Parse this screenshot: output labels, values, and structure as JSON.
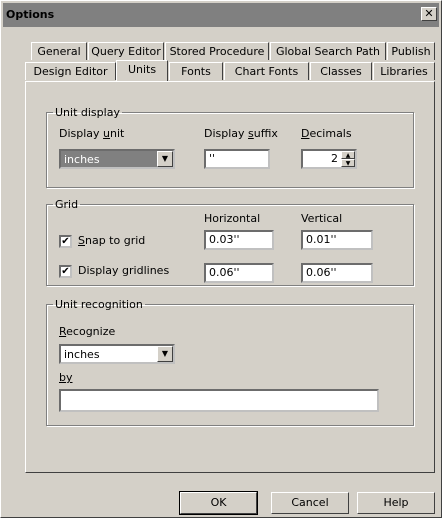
{
  "window": {
    "title": "Options",
    "close_glyph": "✕"
  },
  "tabs_back_row": [
    {
      "label": "General"
    },
    {
      "label": "Query Editor"
    },
    {
      "label": "Stored Procedure"
    },
    {
      "label": "Global Search Path"
    },
    {
      "label": "Publish"
    }
  ],
  "tabs_front_row": [
    {
      "label": "Design Editor"
    },
    {
      "label": "Units",
      "active": true
    },
    {
      "label": "Fonts"
    },
    {
      "label": "Chart Fonts"
    },
    {
      "label": "Classes"
    },
    {
      "label": "Libraries"
    }
  ],
  "unit_display": {
    "legend": "Unit display",
    "display_unit_label_pre": "Display ",
    "display_unit_label_key": "u",
    "display_unit_label_post": "nit",
    "display_unit_value": "inches",
    "display_suffix_label_pre": "Display ",
    "display_suffix_label_key": "s",
    "display_suffix_label_post": "uffix",
    "display_suffix_value": "''",
    "decimals_label_key": "D",
    "decimals_label_post": "ecimals",
    "decimals_value": "2"
  },
  "grid": {
    "legend": "Grid",
    "horizontal_label": "Horizontal",
    "vertical_label": "Vertical",
    "snap_label_key": "S",
    "snap_label_post": "nap to grid",
    "snap_checked": true,
    "snap_horizontal": "0.03''",
    "snap_vertical": "0.01''",
    "gridlines_label": "Display gridlines",
    "gridlines_checked": true,
    "gridlines_horizontal": "0.06''",
    "gridlines_vertical": "0.06''"
  },
  "unit_recognition": {
    "legend": "Unit recognition",
    "recognize_label_key": "R",
    "recognize_label_post": "ecognize",
    "recognize_value": "inches",
    "by_label": "by",
    "by_value": ""
  },
  "buttons": {
    "ok": "OK",
    "cancel": "Cancel",
    "help": "Help"
  },
  "check_glyph": "✔",
  "dropdown_glyph": "▼",
  "spin_up_glyph": "▲",
  "spin_down_glyph": "▼"
}
